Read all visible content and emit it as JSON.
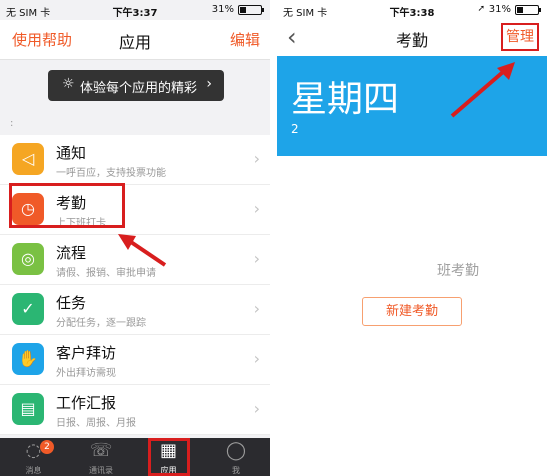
{
  "left_screen": {
    "status": {
      "carrier": "无 SIM 卡",
      "time": "下午3:37",
      "battery": "31%"
    },
    "navbar": {
      "left": "使用帮助",
      "title": "应用",
      "right": "编辑"
    },
    "banner": {
      "text": "体验每个应用的精彩"
    },
    "section_header": ":",
    "apps": [
      {
        "name": "通知",
        "sub": "一呼百应，支持投票功能",
        "color": "#f5a623",
        "icon": "speaker-icon",
        "glyph": "◁"
      },
      {
        "name": "考勤",
        "sub": "上下班打卡",
        "color": "#f05a28",
        "icon": "clock-icon",
        "glyph": "◷"
      },
      {
        "name": "流程",
        "sub": "请假、报销、审批申请",
        "color": "#7ac143",
        "icon": "flow-icon",
        "glyph": "◎"
      },
      {
        "name": "任务",
        "sub": "分配任务，逐一跟踪",
        "color": "#2bb673",
        "icon": "check-icon",
        "glyph": "✓"
      },
      {
        "name": "客户拜访",
        "sub": "外出拜访需现",
        "color": "#1ea4e8",
        "icon": "handshake-icon",
        "glyph": "✋"
      },
      {
        "name": "工作汇报",
        "sub": "日报、周报、月报",
        "color": "#2bb673",
        "icon": "report-icon",
        "glyph": "▤"
      }
    ],
    "tabbar": [
      {
        "label": "消息",
        "icon": "chat-icon",
        "glyph": "◌",
        "badge": "2"
      },
      {
        "label": "通讯录",
        "icon": "phone-icon",
        "glyph": "☏"
      },
      {
        "label": "应用",
        "icon": "grid-icon",
        "glyph": "▦"
      },
      {
        "label": "我",
        "icon": "person-icon",
        "glyph": "◯"
      }
    ]
  },
  "right_screen": {
    "status": {
      "carrier": "无 SIM 卡",
      "time": "下午3:38",
      "battery": "31%"
    },
    "navbar": {
      "back": "‹",
      "title": "考勤",
      "right": "管理"
    },
    "header": {
      "weekday": "星期四",
      "date": "2"
    },
    "empty_text": "班考勤",
    "new_button": "新建考勤"
  },
  "colors": {
    "accent": "#f05a28",
    "blue": "#1ea4e8",
    "highlight": "#d81e1e",
    "tabbar": "#2b2b2f"
  }
}
